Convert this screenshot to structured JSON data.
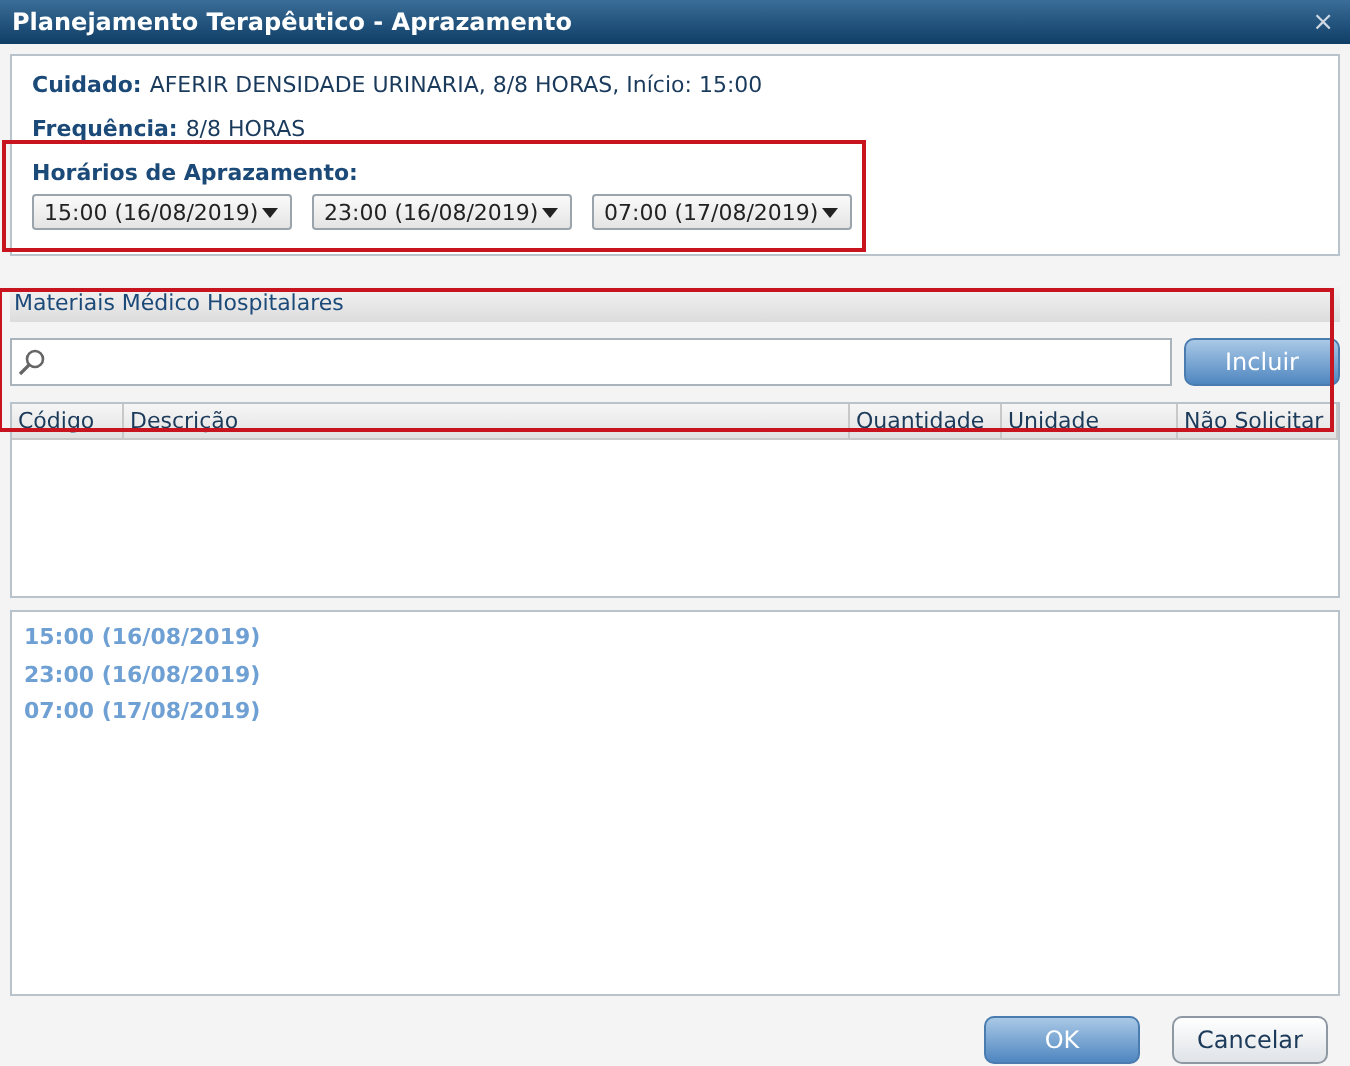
{
  "window": {
    "title": "Planejamento Terapêutico - Aprazamento",
    "close": "×"
  },
  "info": [
    {
      "label": "Cuidado:",
      "value": "AFERIR DENSIDADE URINARIA, 8/8 HORAS, Início: 15:00"
    },
    {
      "label": "Frequência:",
      "value": "8/8 HORAS"
    }
  ],
  "schedule": {
    "label": "Horários de Aprazamento:",
    "selects": [
      "15:00 (16/08/2019)",
      "23:00 (16/08/2019)",
      "07:00 (17/08/2019)"
    ]
  },
  "materials": {
    "title": "Materiais Médico Hospitalares",
    "button": "Incluir",
    "columns": [
      "Código",
      "Descrição",
      "Quantidade",
      "Unidade",
      "Não Solicitar"
    ]
  },
  "times": [
    "15:00 (16/08/2019)",
    "23:00 (16/08/2019)",
    "07:00 (17/08/2019)"
  ],
  "buttons": [
    {
      "label": "OK",
      "kind": "primary"
    },
    {
      "label": "Cancelar",
      "kind": "secondary"
    }
  ]
}
